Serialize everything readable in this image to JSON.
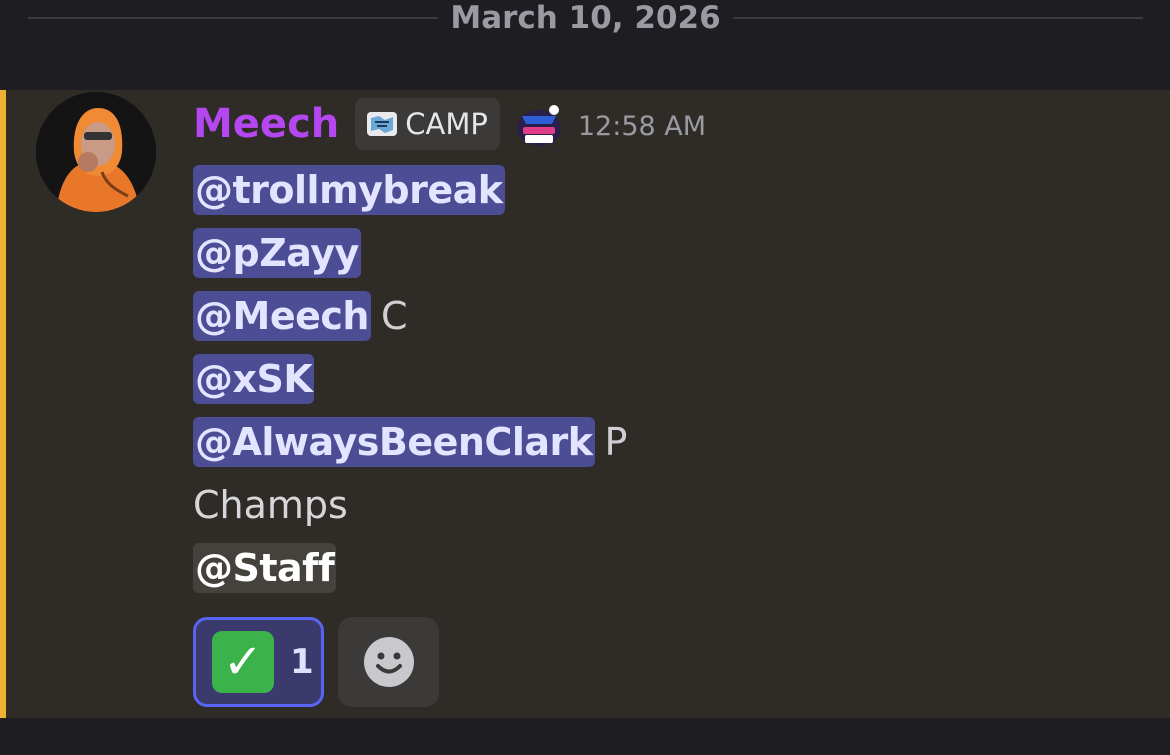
{
  "date_divider": {
    "label": "March 10, 2026"
  },
  "message": {
    "author": {
      "name": "Meech",
      "name_color": "#b547f0"
    },
    "tag": {
      "label": "CAMP",
      "icon": "camp-server-tag-icon"
    },
    "role_icon": "majik-elite-camp-role-icon",
    "timestamp": "12:58 AM",
    "accent_color": "#f0b232",
    "lines": [
      {
        "mention": "@trollmybreak",
        "suffix": ""
      },
      {
        "mention": "@pZayy",
        "suffix": ""
      },
      {
        "mention": "@Meech",
        "suffix": "C"
      },
      {
        "mention": "@xSK",
        "suffix": ""
      },
      {
        "mention": "@AlwaysBeenClark",
        "suffix": "P"
      }
    ],
    "plain_text": "Champs",
    "role_mention": "@Staff",
    "reactions": [
      {
        "emoji": "✓",
        "emoji_name": "white-check-mark",
        "count": "1"
      }
    ],
    "add_reaction_icon": "smiley-icon"
  }
}
